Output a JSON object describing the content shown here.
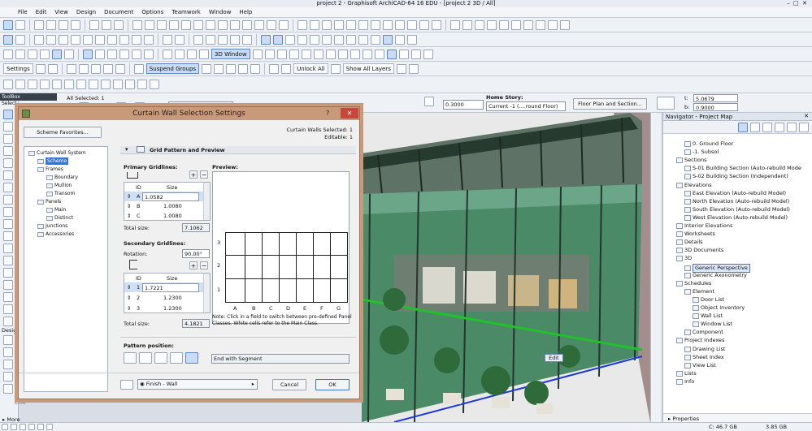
{
  "window": {
    "title": "project 2 - Graphisoft ArchiCAD-64 16 EDU - [project 2 3D / All]"
  },
  "menu": [
    "File",
    "Edit",
    "View",
    "Design",
    "Document",
    "Options",
    "Teamwork",
    "Window",
    "Help"
  ],
  "toolbar3": {
    "view_3d": "3D Window"
  },
  "toolbar4": {
    "settings": "Settings",
    "suspend_groups": "Suspend Groups",
    "unlock_all": "Unlock All",
    "show_all_layers": "Show All Layers"
  },
  "infobox": {
    "all_selected": "All Selected: 1",
    "finish": "Finish - Wall",
    "value1": "0.3000",
    "home_story_label": "Home Story:",
    "home_story": "Current -1 (....round Floor)",
    "floor_plan_btn": "Floor Plan and Section...",
    "t_label": "t:",
    "t_value": "5.0679",
    "b_label": "b:",
    "b_value": "0.9000"
  },
  "toolbox": {
    "title": "ToolBox",
    "select": "Select",
    "design": "Design",
    "line": "Line",
    "more": "More"
  },
  "dialog": {
    "title": "Curtain Wall Selection Settings",
    "help": "?",
    "scheme_favorites": "Scheme Favorites...",
    "selected_info": "Curtain Walls Selected: 1",
    "editable_info": "Editable: 1",
    "section_header": "Grid Pattern and Preview",
    "primary_title": "Primary Gridlines:",
    "id_col": "ID",
    "size_col": "Size",
    "primary_rows": [
      {
        "id": "A",
        "size": "1.0582"
      },
      {
        "id": "B",
        "size": "1.0080"
      },
      {
        "id": "C",
        "size": "1.0080"
      }
    ],
    "total_size_label": "Total size:",
    "primary_total": "7.1062",
    "secondary_title": "Secondary Gridlines:",
    "rotation_label": "Rotation:",
    "rotation_value": "90.00°",
    "secondary_rows": [
      {
        "id": "1",
        "size": "1.7221"
      },
      {
        "id": "2",
        "size": "1.2300"
      },
      {
        "id": "3",
        "size": "1.2300"
      }
    ],
    "secondary_total": "4.1821",
    "preview_title": "Preview:",
    "preview_y_labels": [
      "3",
      "2",
      "1"
    ],
    "preview_x_labels": [
      "A",
      "B",
      "C",
      "D",
      "E",
      "F",
      "G"
    ],
    "note": "Note: Click in a field to switch between pre-defined Panel Classes. White cells refer to the Main Class.",
    "pattern_position": "Pattern position:",
    "pattern_value": "End with Segment",
    "finish": "Finish - Wall",
    "cancel": "Cancel",
    "ok": "OK",
    "tree": [
      {
        "label": "Curtain Wall System",
        "level": 0
      },
      {
        "label": "Scheme",
        "level": 1,
        "selected": true
      },
      {
        "label": "Frames",
        "level": 1
      },
      {
        "label": "Boundary",
        "level": 2
      },
      {
        "label": "Mullion",
        "level": 2
      },
      {
        "label": "Transom",
        "level": 2
      },
      {
        "label": "Panels",
        "level": 1
      },
      {
        "label": "Main",
        "level": 2
      },
      {
        "label": "Distinct",
        "level": 2
      },
      {
        "label": "Junctions",
        "level": 1
      },
      {
        "label": "Accessories",
        "level": 1
      }
    ]
  },
  "viewport": {
    "edit_tag": "Edit"
  },
  "navigator": {
    "title": "Navigator - Project Map",
    "items": [
      {
        "label": "0. Ground Floor",
        "level": 2
      },
      {
        "label": "-1. Subsol",
        "level": 2
      },
      {
        "label": "Sections",
        "level": 1
      },
      {
        "label": "S-01 Building Section (Auto-rebuild Mode",
        "level": 2
      },
      {
        "label": "S-02 Building Section (Independent)",
        "level": 2
      },
      {
        "label": "Elevations",
        "level": 1
      },
      {
        "label": "East Elevation (Auto-rebuild Model)",
        "level": 2
      },
      {
        "label": "North Elevation (Auto-rebuild Model)",
        "level": 2
      },
      {
        "label": "South Elevation (Auto-rebuild Model)",
        "level": 2
      },
      {
        "label": "West Elevation (Auto-rebuild Model)",
        "level": 2
      },
      {
        "label": "Interior Elevations",
        "level": 1
      },
      {
        "label": "Worksheets",
        "level": 1
      },
      {
        "label": "Details",
        "level": 1
      },
      {
        "label": "3D Documents",
        "level": 1
      },
      {
        "label": "3D",
        "level": 1
      },
      {
        "label": "Generic Perspective",
        "level": 2,
        "selected": true
      },
      {
        "label": "Generic Axonometry",
        "level": 2
      },
      {
        "label": "Schedules",
        "level": 1
      },
      {
        "label": "Element",
        "level": 2
      },
      {
        "label": "Door List",
        "level": 3
      },
      {
        "label": "Object Inventory",
        "level": 3
      },
      {
        "label": "Wall List",
        "level": 3
      },
      {
        "label": "Window List",
        "level": 3
      },
      {
        "label": "Component",
        "level": 2
      },
      {
        "label": "Project Indexes",
        "level": 1
      },
      {
        "label": "Drawing List",
        "level": 2
      },
      {
        "label": "Sheet Index",
        "level": 2
      },
      {
        "label": "View List",
        "level": 2
      },
      {
        "label": "Lists",
        "level": 1
      },
      {
        "label": "Info",
        "level": 1
      }
    ],
    "properties": "Properties"
  },
  "status": {
    "disk_c": "C: 46.7 GB",
    "disk_d": "3.85 GB"
  },
  "colors": {
    "dialog_title": "#c89a7a",
    "selection": "#4b76b8",
    "wall_green": "#4a8a66"
  }
}
